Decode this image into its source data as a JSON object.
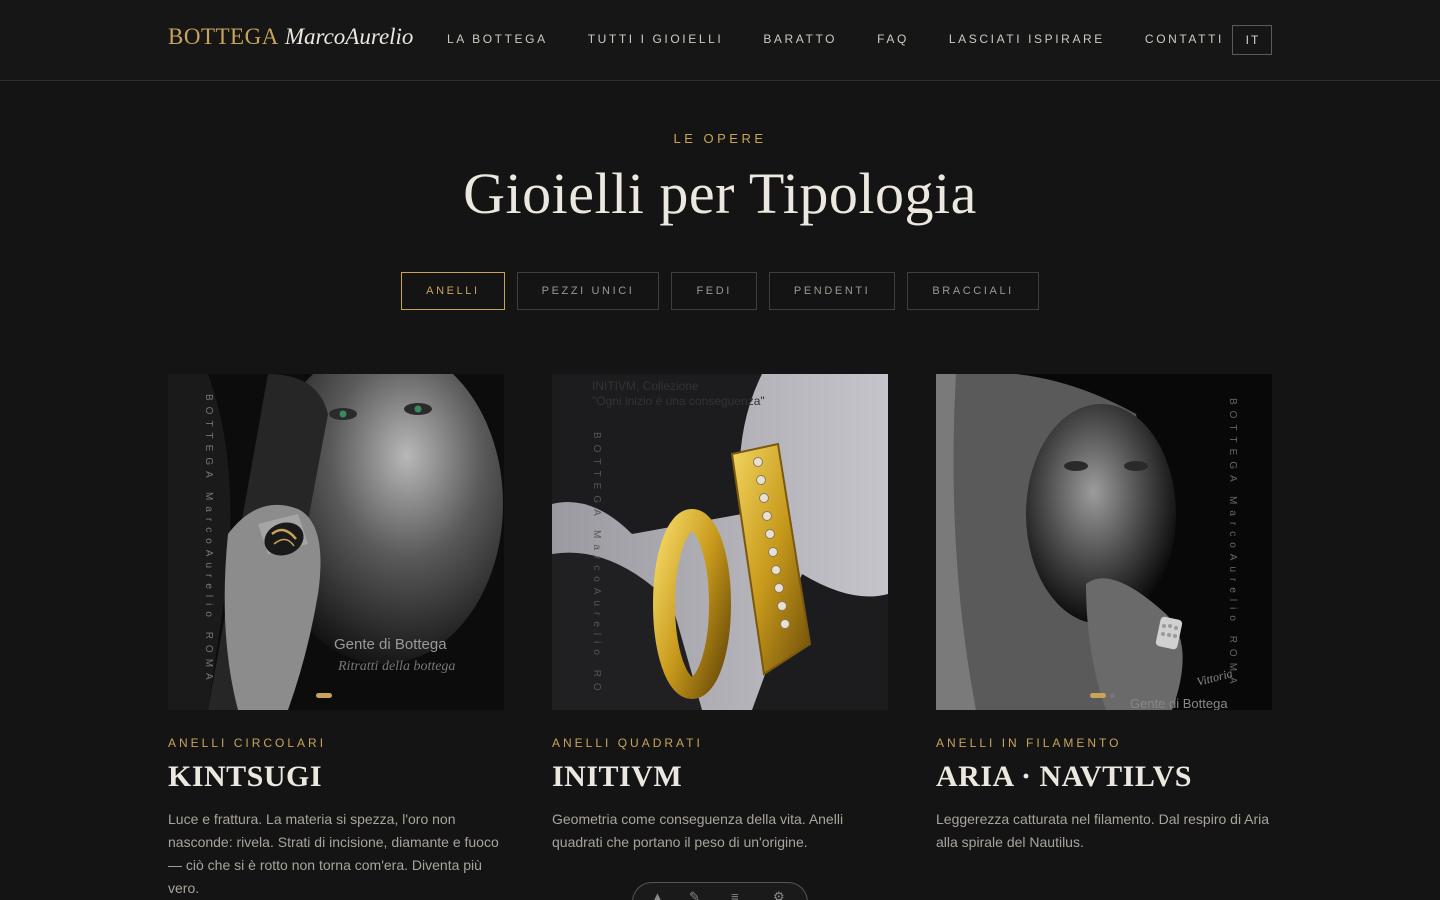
{
  "nav": {
    "brand": "BOTTEGA",
    "name": "MarcoAurelio",
    "items": [
      "LA BOTTEGA",
      "TUTTI I GIOIELLI",
      "BARATTO",
      "FAQ",
      "LASCIATI ISPIRARE",
      "CONTATTI"
    ],
    "lang": "IT"
  },
  "hero": {
    "eyebrow": "LE OPERE",
    "title": "Gioielli per Tipologia"
  },
  "filters": [
    "ANELLI",
    "PEZZI UNICI",
    "FEDI",
    "PENDENTI",
    "BRACCIALI"
  ],
  "cards": [
    {
      "category": "ANELLI CIRCOLARI",
      "title": "KINTSUGI",
      "description": "Luce e frattura. La materia si spezza, l'oro non nasconde: rivela. Strati di incisione, diamante e fuoco — ciò che si è rotto non torna com'era. Diventa più vero.",
      "overlay_top": "BOTTEGA MarcoAurelio ROMA",
      "overlay_caption": "Gente di Bottega",
      "overlay_sub": "Ritratti della bottega"
    },
    {
      "category": "ANELLI QUADRATI",
      "title": "INITIVM",
      "description": "Geometria come conseguenza della vita. Anelli quadrati che portano il peso di un'origine.",
      "overlay_top": "INITIVM, Collezione",
      "overlay_caption": "\"Ogni inizio è una conseguenza\""
    },
    {
      "category": "ANELLI IN FILAMENTO",
      "title": "ARIA · NAVTILVS",
      "description": "Leggerezza catturata nel filamento. Dal respiro di Aria alla spirale del Nautilus.",
      "overlay_caption": "Gente di Bottega",
      "overlay_sub": "Vittoria"
    }
  ],
  "colors": {
    "background": "#141414",
    "accent": "#c8a45a",
    "text": "#ece8e0"
  }
}
